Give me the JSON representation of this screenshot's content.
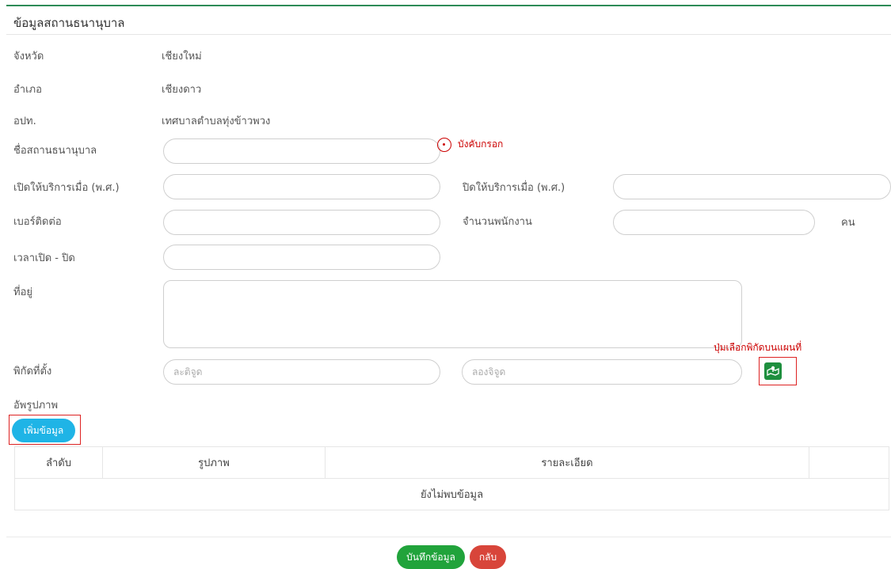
{
  "panel": {
    "title": "ข้อมูลสถานธนานุบาล"
  },
  "fields": {
    "province": {
      "label": "จังหวัด",
      "value": "เชียงใหม่"
    },
    "district": {
      "label": "อำเภอ",
      "value": "เชียงดาว"
    },
    "local_org": {
      "label": "อปท.",
      "value": "เทศบาลตำบลทุ่งข้าวพวง"
    },
    "name": {
      "label": "ชื่อสถานธนานุบาล",
      "value": ""
    },
    "open_year": {
      "label": "เปิดให้บริการเมื่อ (พ.ศ.)",
      "value": ""
    },
    "close_year": {
      "label": "ปิดให้บริการเมื่อ (พ.ศ.)",
      "value": ""
    },
    "phone": {
      "label": "เบอร์ติดต่อ",
      "value": ""
    },
    "staff_count": {
      "label": "จำนวนพนักงาน",
      "value": "",
      "unit": "คน"
    },
    "hours": {
      "label": "เวลาเปิด - ปิด",
      "value": ""
    },
    "address": {
      "label": "ที่อยู่",
      "value": ""
    },
    "coords": {
      "label": "พิกัดที่ตั้ง",
      "lat_placeholder": "ละติจูด",
      "lng_placeholder": "ลองจิจูด"
    },
    "upload": {
      "label": "อัพรูปภาพ"
    }
  },
  "annotations": {
    "required_note": "บังคับกรอก",
    "map_button_note": "ปุ่มเลือกพิกัดบนแผนที่"
  },
  "buttons": {
    "add_data": "เพิ่มข้อมูล",
    "save": "บันทึกข้อมูล",
    "back": "กลับ"
  },
  "table": {
    "headers": [
      "ลำดับ",
      "รูปภาพ",
      "รายละเอียด",
      ""
    ],
    "empty_text": "ยังไม่พบข้อมูล"
  },
  "colors": {
    "accent_green": "#2e8b57",
    "annotation_red": "#cc0000",
    "add_button": "#1fb4e6",
    "save_button": "#21a33b",
    "back_button": "#d8453a"
  }
}
